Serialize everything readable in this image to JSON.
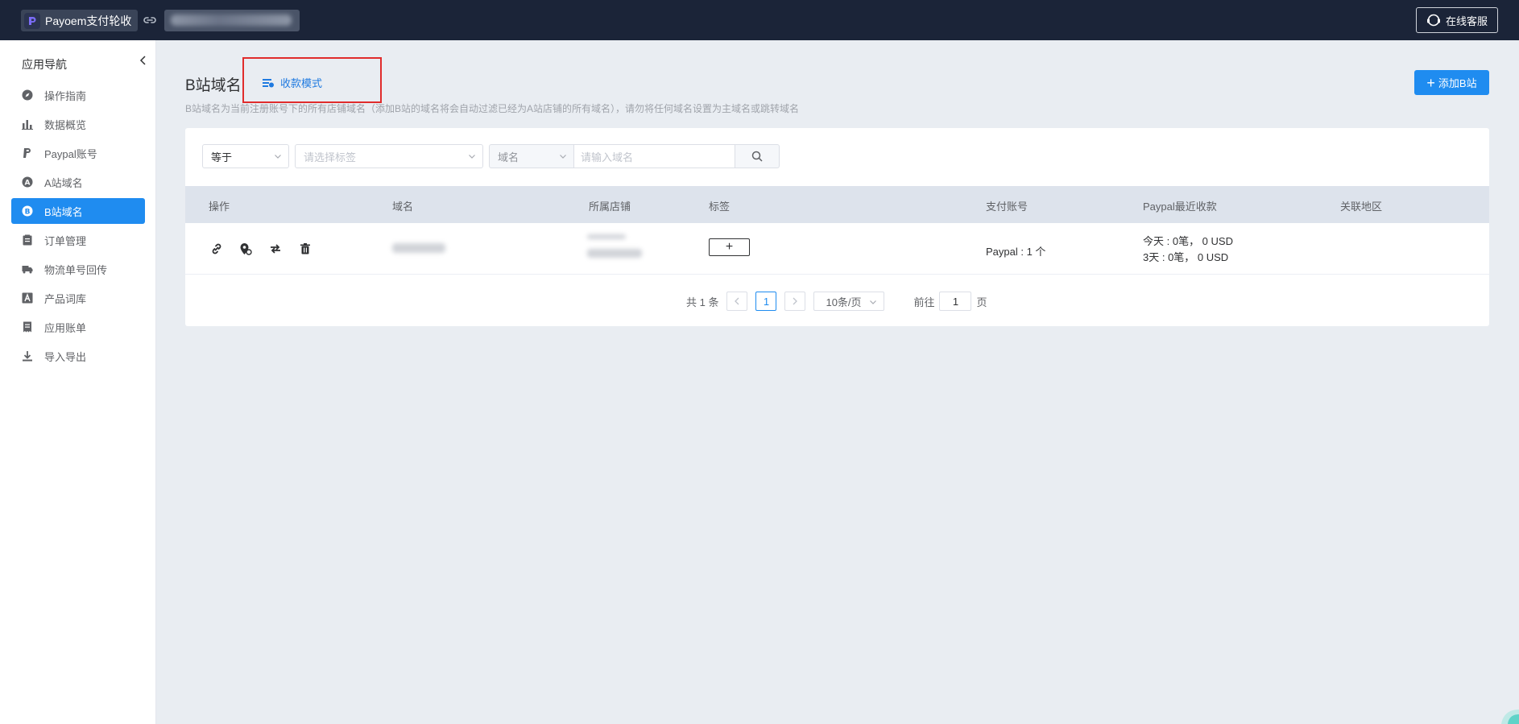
{
  "topbar": {
    "brand": "Payoem支付轮收",
    "service_label": "在线客服"
  },
  "sidebar": {
    "title": "应用导航",
    "items": [
      {
        "label": "操作指南",
        "icon": "compass-icon"
      },
      {
        "label": "数据概览",
        "icon": "bar-chart-icon"
      },
      {
        "label": "Paypal账号",
        "icon": "paypal-icon"
      },
      {
        "label": "A站域名",
        "icon": "letter-a-icon"
      },
      {
        "label": "B站域名",
        "icon": "letter-b-icon",
        "active": true
      },
      {
        "label": "订单管理",
        "icon": "clipboard-icon"
      },
      {
        "label": "物流单号回传",
        "icon": "truck-icon"
      },
      {
        "label": "产品词库",
        "icon": "font-icon"
      },
      {
        "label": "应用账单",
        "icon": "receipt-icon"
      },
      {
        "label": "导入导出",
        "icon": "download-icon"
      }
    ]
  },
  "header": {
    "title": "B站域名",
    "mode_link": "收款模式",
    "description": "B站域名为当前注册账号下的所有店铺域名（添加B站的域名将会自动过滤已经为A站店铺的所有域名），请勿将任何域名设置为主域名或跳转域名",
    "add_button": "添加B站"
  },
  "filters": {
    "operator": "等于",
    "tag_placeholder": "请选择标签",
    "field": "域名",
    "domain_placeholder": "请输入域名"
  },
  "table": {
    "columns": [
      "操作",
      "域名",
      "所属店铺",
      "标签",
      "支付账号",
      "Paypal最近收款",
      "关联地区"
    ],
    "rows": [
      {
        "actions": [
          "link-icon",
          "location-link-icon",
          "swap-icon",
          "trash-icon"
        ],
        "tag_add": "+",
        "pay_account": "Paypal : 1 个",
        "recent_today": "今天 : 0笔，  0 USD",
        "recent_3days": "3天 : 0笔，  0 USD",
        "region": ""
      }
    ]
  },
  "pagination": {
    "total": "共 1 条",
    "current_page": "1",
    "page_size": "10条/页",
    "goto_label": "前往",
    "goto_value": "1",
    "page_suffix": "页"
  },
  "colors": {
    "topbar": "#1b2438",
    "accent": "#1f8cf0",
    "highlight_box": "#e02c2c"
  }
}
